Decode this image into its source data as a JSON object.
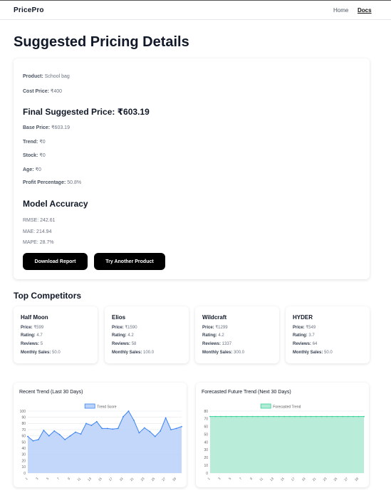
{
  "nav": {
    "brand": "PricePro",
    "home": "Home",
    "docs": "Docs"
  },
  "page_title": "Suggested Pricing Details",
  "details": {
    "product_label": "Product:",
    "product": "School bag",
    "cost_label": "Cost Price:",
    "cost": "₹400",
    "final_heading": "Final Suggested Price: ₹603.19",
    "base_label": "Base Price:",
    "base": "₹603.19",
    "trend_label": "Trend:",
    "trend": "₹0",
    "stock_label": "Stock:",
    "stock": "₹0",
    "age_label": "Age:",
    "age": "₹0",
    "profit_label": "Profit Percentage:",
    "profit": "50.8%"
  },
  "accuracy": {
    "heading": "Model Accuracy",
    "rmse": "RMSE: 242.61",
    "mae": "MAE: 214.94",
    "mape": "MAPE: 28.7%"
  },
  "buttons": {
    "download": "Download Report",
    "try_another": "Try Another Product"
  },
  "competitors_title": "Top Competitors",
  "labels": {
    "price": "Price:",
    "rating": "Rating:",
    "reviews": "Reviews:",
    "monthly_sales": "Monthly Sales:"
  },
  "competitors": [
    {
      "name": "Half Moon",
      "price": "₹599",
      "rating": "4.7",
      "reviews": "5",
      "monthly_sales": "50.0"
    },
    {
      "name": "Elios",
      "price": "₹1590",
      "rating": "4.2",
      "reviews": "58",
      "monthly_sales": "100.0"
    },
    {
      "name": "Wildcraft",
      "price": "₹1299",
      "rating": "4.2",
      "reviews": "1337",
      "monthly_sales": "300.0"
    },
    {
      "name": "HYDER",
      "price": "₹549",
      "rating": "3.7",
      "reviews": "64",
      "monthly_sales": "50.0"
    }
  ],
  "chart_data": [
    {
      "type": "area",
      "title": "Recent Trend (Last 30 Days)",
      "series": [
        {
          "name": "Trend Score",
          "color": "#3b82f6",
          "fill": "#bcd3f9",
          "values": [
            59,
            52,
            54,
            69,
            60,
            68,
            62,
            54,
            60,
            66,
            63,
            80,
            77,
            83,
            72,
            72,
            71,
            72,
            91,
            100,
            85,
            65,
            73,
            67,
            59,
            68,
            89,
            70,
            72,
            75
          ]
        }
      ],
      "x": [
        1,
        2,
        3,
        4,
        5,
        6,
        7,
        8,
        9,
        10,
        11,
        12,
        13,
        14,
        15,
        16,
        17,
        18,
        19,
        20,
        21,
        22,
        23,
        24,
        25,
        26,
        27,
        28,
        29,
        30
      ],
      "x_tick_labels": [
        "1",
        "3",
        "5",
        "7",
        "9",
        "11",
        "13",
        "15",
        "17",
        "19",
        "21",
        "23",
        "25",
        "27",
        "29"
      ],
      "ylim": [
        0,
        100
      ],
      "y_ticks": [
        0,
        10,
        20,
        30,
        40,
        50,
        60,
        70,
        80,
        90,
        100
      ],
      "legend": "top-center",
      "grid": true
    },
    {
      "type": "area",
      "title": "Forecasted Future Trend (Next 30 Days)",
      "series": [
        {
          "name": "Forecasted Trend",
          "color": "#34d399",
          "fill": "#b2ebd5",
          "values": [
            73,
            73,
            73,
            73,
            73,
            73,
            73,
            73,
            73,
            73,
            73,
            73,
            73,
            73,
            73,
            73,
            73,
            73,
            73,
            73,
            73,
            73,
            73,
            73,
            73,
            73,
            73,
            73,
            73,
            73
          ]
        }
      ],
      "x": [
        1,
        2,
        3,
        4,
        5,
        6,
        7,
        8,
        9,
        10,
        11,
        12,
        13,
        14,
        15,
        16,
        17,
        18,
        19,
        20,
        21,
        22,
        23,
        24,
        25,
        26,
        27,
        28,
        29,
        30
      ],
      "x_tick_labels": [
        "1",
        "3",
        "5",
        "7",
        "9",
        "11",
        "13",
        "15",
        "17",
        "19",
        "21",
        "23",
        "25",
        "27",
        "29"
      ],
      "ylim": [
        0,
        80
      ],
      "y_ticks": [
        0,
        10,
        20,
        30,
        40,
        50,
        60,
        70,
        80
      ],
      "legend": "top-center",
      "grid": true
    }
  ]
}
